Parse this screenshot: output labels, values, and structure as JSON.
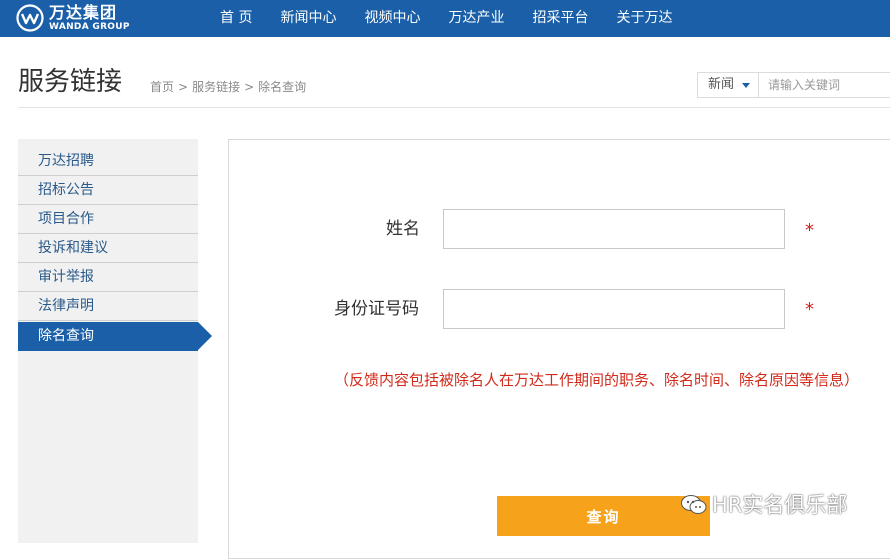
{
  "header": {
    "logo_cn": "万达集团",
    "logo_en": "WANDA GROUP",
    "nav": [
      "首 页",
      "新闻中心",
      "视频中心",
      "万达产业",
      "招采平台",
      "关于万达"
    ]
  },
  "page": {
    "title": "服务链接",
    "breadcrumb": [
      "首页",
      "服务链接",
      "除名查询"
    ],
    "breadcrumb_sep": ">"
  },
  "search": {
    "category": "新闻",
    "placeholder": "请输入关键词"
  },
  "sidebar": {
    "items": [
      {
        "label": "万达招聘"
      },
      {
        "label": "招标公告"
      },
      {
        "label": "项目合作"
      },
      {
        "label": "投诉和建议"
      },
      {
        "label": "审计举报"
      },
      {
        "label": "法律声明"
      },
      {
        "label": "除名查询",
        "active": true
      }
    ]
  },
  "form": {
    "name_label": "姓名",
    "id_label": "身份证号码",
    "required_mark": "*",
    "notice": "（反馈内容包括被除名人在万达工作期间的职务、除名时间、除名原因等信息）",
    "submit_label": "查询"
  },
  "watermark": {
    "text": "HR实名俱乐部",
    "icon": "wechat-icon"
  },
  "colors": {
    "brand_blue": "#1a5fa8",
    "button_orange": "#f7a21b",
    "notice_red": "#d12a1a"
  }
}
